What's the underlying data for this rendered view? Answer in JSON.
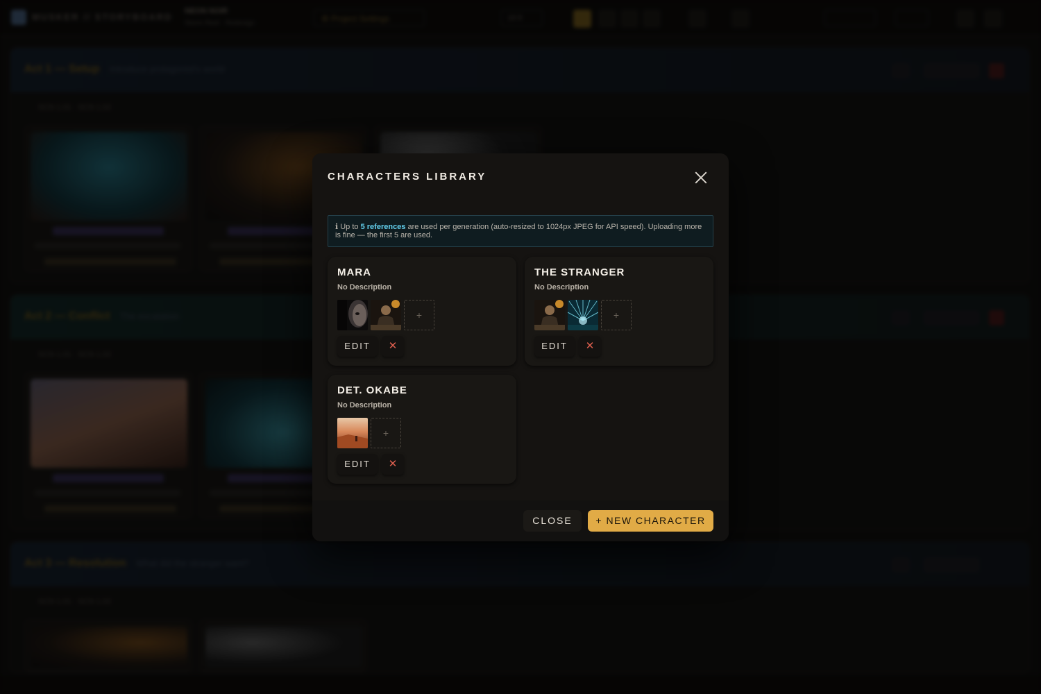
{
  "background": {
    "brand": "MUSKER // STORYBOARD",
    "project_title": "NEON NOIR",
    "project_subtitle": "Storm Reel · Redesign",
    "project_settings": "⚙ Project Settings",
    "aspect": "16:9",
    "acts": [
      {
        "title": "Act 1 — Setup",
        "subtitle": "Introduce protagonist's world"
      },
      {
        "title": "Act 2 — Conflict",
        "subtitle": "The escalation"
      },
      {
        "title": "Act 3 — Resolution",
        "subtitle": "What did the stranger want?"
      }
    ],
    "scene_bar": "SCN 1.01 · SCN 1.02"
  },
  "modal": {
    "title": "CHARACTERS LIBRARY",
    "info_prefix": "ℹ Up to ",
    "info_highlight": "5 references",
    "info_suffix": " are used per generation (auto-resized to 1024px JPEG for API speed). Uploading more is fine — the first 5 are used.",
    "edit_label": "EDIT",
    "delete_label": "✕",
    "add_label": "+",
    "characters": [
      {
        "name": "MARA",
        "description": "No Description"
      },
      {
        "name": "THE STRANGER",
        "description": "No Description"
      },
      {
        "name": "DET. OKABE",
        "description": "No Description"
      }
    ],
    "footer": {
      "close_label": "CLOSE",
      "new_label": "+ NEW CHARACTER"
    }
  },
  "colors": {
    "accent": "#e1ab46",
    "info_highlight": "#63d0ee",
    "danger": "#e0604f"
  }
}
